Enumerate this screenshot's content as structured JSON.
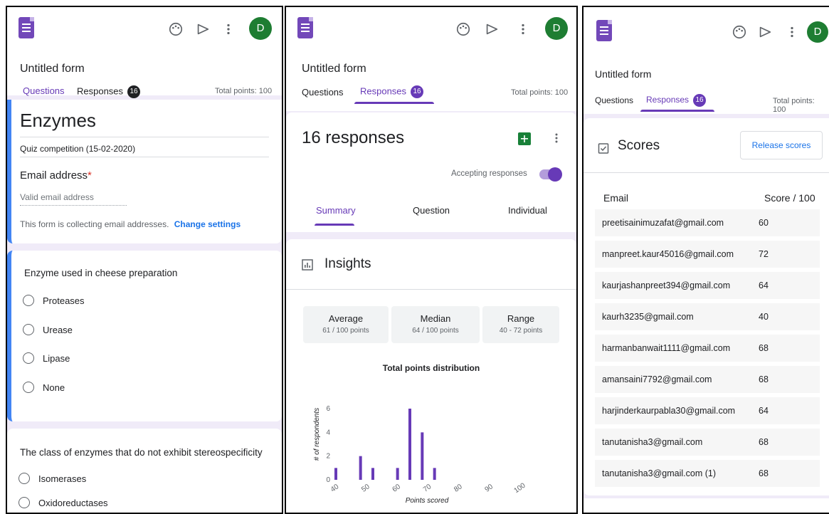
{
  "app": {
    "form_title": "Untitled form",
    "tab_questions": "Questions",
    "tab_responses": "Responses",
    "response_count": "16",
    "total_points": "Total points: 100",
    "avatar_letter": "D"
  },
  "panel1": {
    "quiz_title": "Enzymes",
    "quiz_description": "Quiz competition (15-02-2020)",
    "email_label": "Email address",
    "required_star": "*",
    "email_placeholder": "Valid email address",
    "collecting_note": "This form is collecting email addresses.",
    "change_settings": "Change settings",
    "q1": {
      "title": "Enzyme used in cheese preparation",
      "options": [
        "Proteases",
        "Urease",
        "Lipase",
        "None"
      ]
    },
    "q2": {
      "title": "The class of enzymes that do not exhibit stereospecificity",
      "options": [
        "Isomerases",
        "Oxidoreductases"
      ]
    }
  },
  "panel2": {
    "responses_heading": "16 responses",
    "accepting_label": "Accepting responses",
    "accepting_on": true,
    "view_tabs": [
      "Summary",
      "Question",
      "Individual"
    ],
    "insights_title": "Insights",
    "stats": [
      {
        "label": "Average",
        "value": "61 / 100 points"
      },
      {
        "label": "Median",
        "value": "64 / 100 points"
      },
      {
        "label": "Range",
        "value": "40 - 72 points"
      }
    ]
  },
  "chart_data": {
    "type": "bar",
    "title": "Total points distribution",
    "xlabel": "Points scored",
    "ylabel": "# of respondents",
    "xlim": [
      40,
      100
    ],
    "ylim": [
      0,
      6
    ],
    "x_ticks": [
      40,
      50,
      60,
      70,
      80,
      90,
      100
    ],
    "y_ticks": [
      0,
      2,
      4,
      6
    ],
    "x": [
      40,
      48,
      52,
      60,
      64,
      68,
      72
    ],
    "values": [
      1,
      2,
      1,
      1,
      6,
      4,
      1
    ],
    "bar_color": "#673ab7",
    "grid": false
  },
  "panel3": {
    "scores_title": "Scores",
    "release_scores": "Release scores",
    "col_email": "Email",
    "col_score": "Score / 100",
    "rows": [
      {
        "email": "preetisainimuzafat@gmail.com",
        "score": "60"
      },
      {
        "email": "manpreet.kaur45016@gmail.com",
        "score": "72"
      },
      {
        "email": "kaurjashanpreet394@gmail.com",
        "score": "64"
      },
      {
        "email": "kaurh3235@gmail.com",
        "score": "40"
      },
      {
        "email": "harmanbanwait1111@gmail.com",
        "score": "68"
      },
      {
        "email": "amansaini7792@gmail.com",
        "score": "68"
      },
      {
        "email": "harjinderkaurpabla30@gmail.com",
        "score": "64"
      },
      {
        "email": "tanutanisha3@gmail.com",
        "score": "68"
      },
      {
        "email": "tanutanisha3@gmail.com (1)",
        "score": "68"
      }
    ]
  },
  "colors": {
    "accent": "#673ab7",
    "background": "#f0ebf8",
    "question_accent": "#4285f4",
    "avatar": "#1e7d32",
    "sheets": "#188038"
  }
}
